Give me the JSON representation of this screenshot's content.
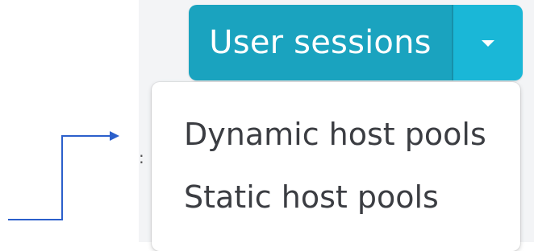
{
  "split_button": {
    "label": "User sessions",
    "toggle_icon": "caret-down-icon",
    "colors": {
      "main": "#1aa3bf",
      "toggle": "#1ab7d7",
      "text": "#ffffff"
    }
  },
  "dropdown": {
    "items": [
      {
        "label": "Dynamic host pools"
      },
      {
        "label": "Static host pools"
      }
    ]
  },
  "annotation": {
    "type": "arrow",
    "color": "#2b5fcb"
  }
}
